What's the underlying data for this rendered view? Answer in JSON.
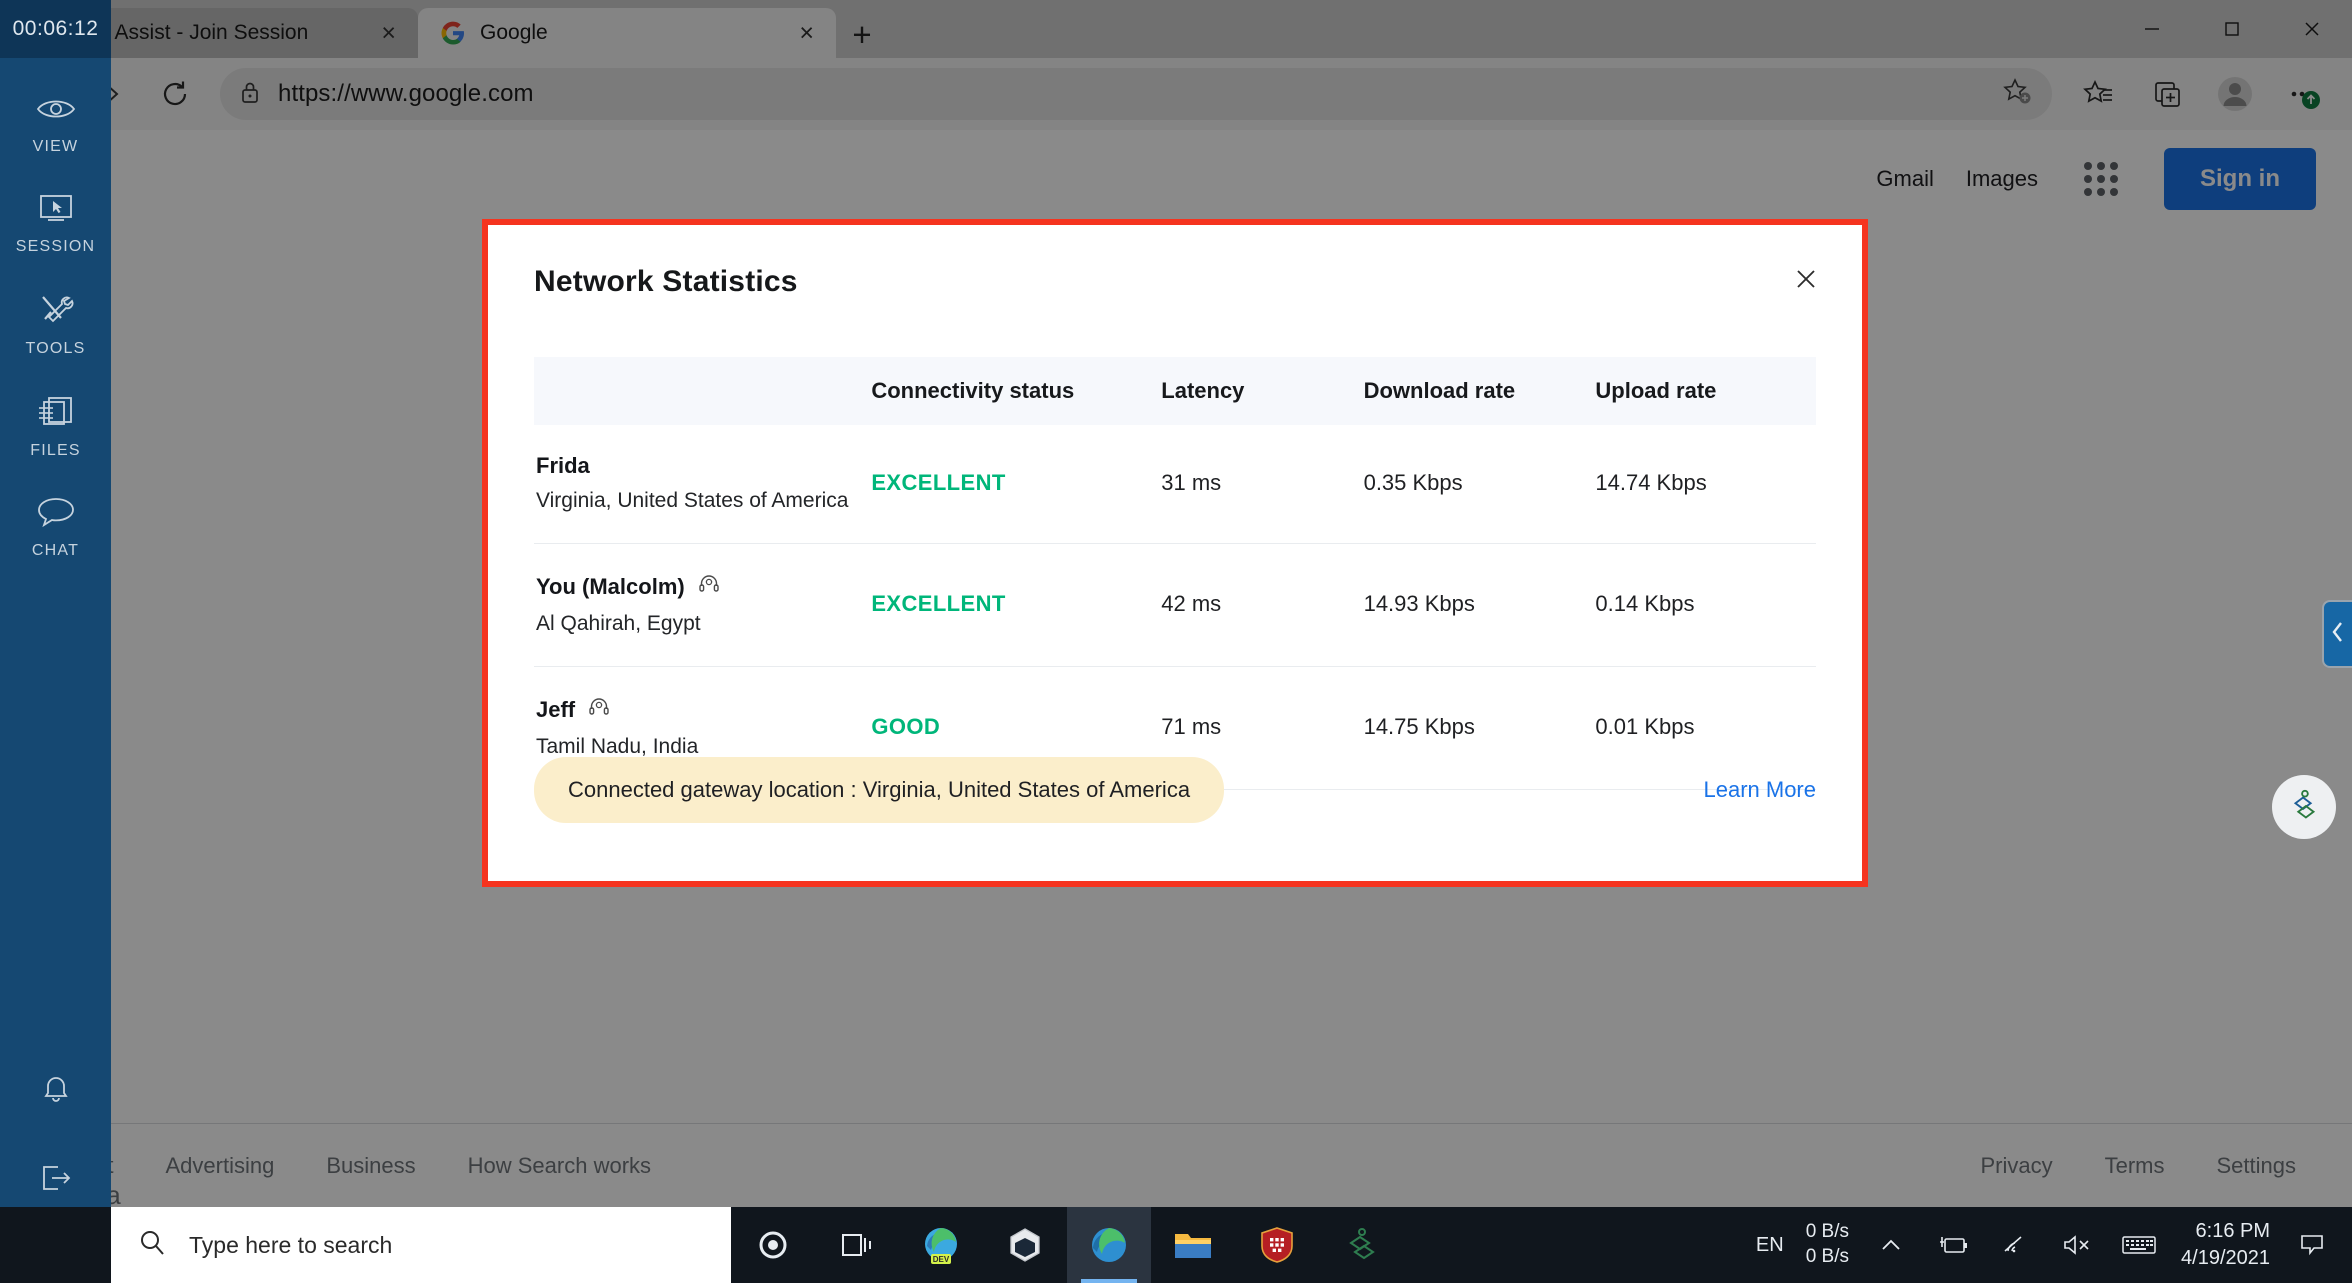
{
  "browser": {
    "tabs": [
      {
        "title": "Zoho Assist - Join Session",
        "favicon": "zoho-icon",
        "active": false,
        "close_label": "×"
      },
      {
        "title": "Google",
        "favicon": "google-icon",
        "active": true,
        "close_label": "×"
      }
    ],
    "new_tab_label": "+",
    "window_controls": {
      "minimize": "─",
      "maximize": "❐",
      "close": "✕"
    },
    "nav": {
      "back": "back-icon",
      "forward": "forward-icon",
      "reload": "reload-icon"
    },
    "address": {
      "url": "https://www.google.com",
      "lock": "lock-icon"
    },
    "toolbar": {
      "favorite": "add-favorite-icon",
      "collections_star": "favorites-list-icon",
      "tabs_aside": "collections-icon",
      "profile": "profile-avatar-icon",
      "settings": "more-options-icon"
    }
  },
  "google_page": {
    "header_links": [
      "Gmail",
      "Images"
    ],
    "apps_label": "google-apps-icon",
    "signin_label": "Sign in",
    "country": "dia",
    "footer_left": [
      "About",
      "Advertising",
      "Business",
      "How Search works"
    ],
    "footer_right": [
      "Privacy",
      "Terms",
      "Settings"
    ]
  },
  "modal": {
    "title": "Network Statistics",
    "close_label": "✕",
    "columns": [
      "",
      "Connectivity status",
      "Latency",
      "Download rate",
      "Upload rate"
    ],
    "rows": [
      {
        "name": "Frida",
        "icon": null,
        "location": "Virginia, United States of America",
        "status": "EXCELLENT",
        "status_color": "#00b67a",
        "latency": "31 ms",
        "download": "0.35 Kbps",
        "upload": "14.74 Kbps"
      },
      {
        "name": "You (Malcolm)",
        "icon": "headset-icon",
        "location": "Al Qahirah, Egypt",
        "status": "EXCELLENT",
        "status_color": "#00b67a",
        "latency": "42 ms",
        "download": "14.93 Kbps",
        "upload": "0.14 Kbps"
      },
      {
        "name": "Jeff",
        "icon": "headset-icon",
        "location": "Tamil Nadu, India",
        "status": "GOOD",
        "status_color": "#00b67a",
        "latency": "71 ms",
        "download": "14.75 Kbps",
        "upload": "0.01 Kbps"
      }
    ],
    "gateway_text": "Connected gateway location : Virginia, United States of America",
    "learn_more": "Learn More",
    "border_color": "#f5341f",
    "gateway_pill_color": "#fbeecb",
    "link_color": "#1a73e8"
  },
  "zoho_sidebar": {
    "timer": "00:06:12",
    "items": [
      {
        "label": "VIEW",
        "icon": "eye-icon"
      },
      {
        "label": "SESSION",
        "icon": "monitor-cursor-icon"
      },
      {
        "label": "TOOLS",
        "icon": "tools-icon"
      },
      {
        "label": "FILES",
        "icon": "files-transfer-icon"
      },
      {
        "label": "CHAT",
        "icon": "chat-bubble-icon"
      }
    ],
    "bottom_items": [
      {
        "label": "",
        "icon": "bell-icon"
      },
      {
        "label": "",
        "icon": "exit-icon"
      }
    ],
    "background": "#154872"
  },
  "edge_panel": {
    "collapse_icon": "chevron-left-icon",
    "logo_icon": "zoho-assist-logo-icon"
  },
  "taskbar": {
    "start_icon": "windows-start-icon",
    "search_placeholder": "Type here to search",
    "search_icon": "search-icon",
    "apps": [
      {
        "name": "cortana-icon"
      },
      {
        "name": "task-view-icon"
      },
      {
        "name": "edge-dev-icon"
      },
      {
        "name": "virtualbox-icon"
      },
      {
        "name": "edge-icon",
        "active": true
      },
      {
        "name": "file-explorer-icon"
      },
      {
        "name": "shield-app-icon"
      },
      {
        "name": "zoho-assist-icon"
      }
    ],
    "tray": {
      "language": "EN",
      "net_up": "0 B/s",
      "net_down": "0 B/s",
      "overflow_icon": "chevron-up-icon",
      "battery_icon": "battery-icon",
      "wifi_icon": "wifi-icon",
      "volume_icon": "volume-muted-icon",
      "keyboard_icon": "keyboard-icon",
      "time": "6:16 PM",
      "date": "4/19/2021",
      "notification_icon": "notification-icon"
    }
  }
}
